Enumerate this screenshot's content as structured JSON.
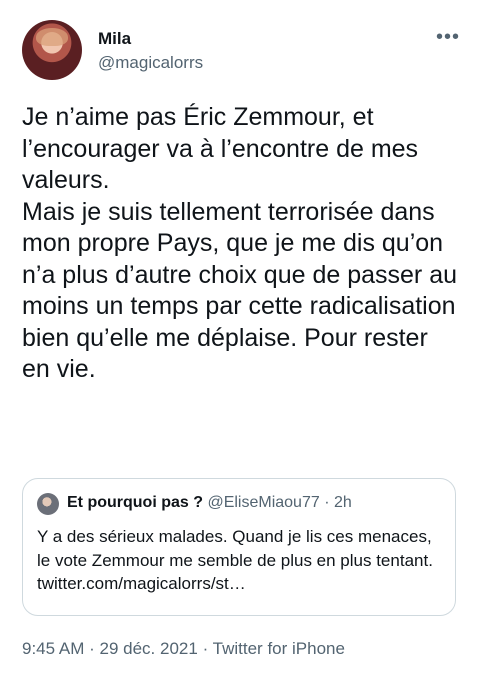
{
  "author": {
    "name": "Mila",
    "handle": "@magicalorrs",
    "more_icon": "more-horizontal-icon"
  },
  "tweet": {
    "paragraphs": [
      "Je n’aime pas Éric Zemmour, et l’encourager va à l’encontre de mes valeurs.",
      "Mais je suis tellement terrorisée dans mon propre Pays, que je me dis qu’on n’a plus d’autre choix que de passer au moins un temps par cette radicalisation bien qu’elle me déplaise. Pour rester en vie."
    ]
  },
  "quoted": {
    "name": "Et pourquoi pas ?",
    "handle": "@EliseMiaou77",
    "separator": "·",
    "time": "2h",
    "text": "Y a des sérieux malades. Quand je lis ces menaces, le vote Zemmour me semble de plus en plus tentant. twitter.com/magicalorrs/st…"
  },
  "meta": {
    "time": "9:45 AM",
    "date": "29 déc. 2021",
    "source": "Twitter for iPhone",
    "separator": "·"
  },
  "colors": {
    "text": "#0f1419",
    "secondary": "#536471",
    "border": "#cfd9de"
  }
}
